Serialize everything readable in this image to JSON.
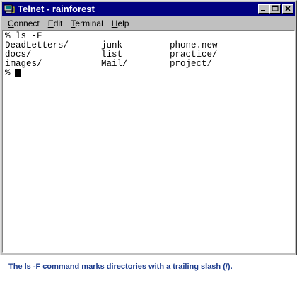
{
  "window": {
    "title": "Telnet - rainforest",
    "app_icon": "telnet-computer-icon",
    "controls": [
      "minimize-icon",
      "maximize-icon",
      "close-icon"
    ]
  },
  "menu": {
    "items": [
      {
        "underline": "C",
        "rest": "onnect"
      },
      {
        "underline": "E",
        "rest": "dit"
      },
      {
        "underline": "T",
        "rest": "erminal"
      },
      {
        "underline": "H",
        "rest": "elp"
      }
    ]
  },
  "terminal": {
    "command_line": "% ls -F",
    "rows": [
      [
        "DeadLetters/",
        "junk",
        "phone.new"
      ],
      [
        "docs/",
        "list",
        "practice/"
      ],
      [
        "images/",
        "Mail/",
        "project/"
      ]
    ],
    "prompt": "%"
  },
  "caption": "The ls -F command marks directories with a trailing slash (/).",
  "colors": {
    "titlebar": "#000080",
    "caption": "#1a3a8c",
    "chrome": "#c0c0c0"
  }
}
